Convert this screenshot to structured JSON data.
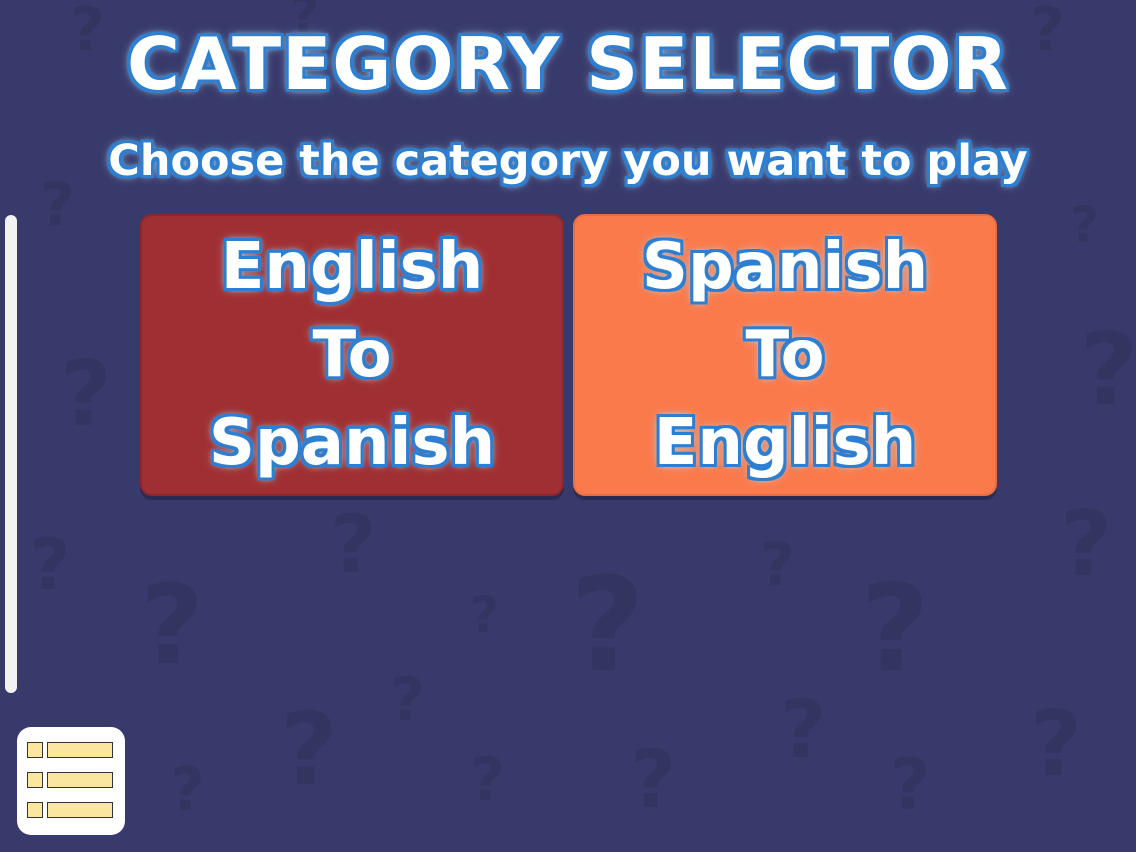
{
  "header": {
    "title": "CATEGORY SELECTOR",
    "subtitle": "Choose the category you want to play"
  },
  "categories": [
    {
      "lines": [
        "English",
        "To",
        "Spanish"
      ],
      "color": "#a02f33"
    },
    {
      "lines": [
        "Spanish",
        "To",
        "English"
      ],
      "color": "#fb7a4c"
    }
  ],
  "background": {
    "color": "#393a6c",
    "pattern_glyph": "?"
  },
  "menu": {
    "icon": "list-menu-icon"
  }
}
